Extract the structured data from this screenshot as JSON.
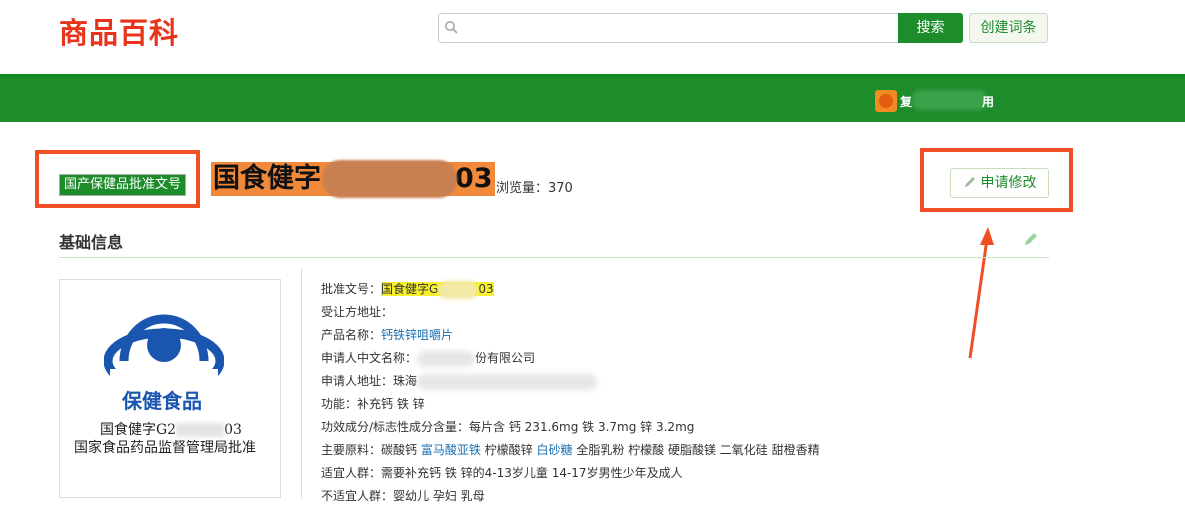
{
  "header": {
    "logo": "商品百科",
    "search_placeholder": "",
    "search_button": "搜索",
    "create_button": "创建词条"
  },
  "user": {
    "name_start": "复",
    "name_end": "用"
  },
  "entry": {
    "type_label": "国产保健品批准文号",
    "title": "国食健字",
    "title_suffix": "03",
    "views_label": "浏览量：",
    "views_value": "370",
    "edit_request_button": "申请修改"
  },
  "section": {
    "title": "基础信息"
  },
  "thumbnail": {
    "logo_text": "保健食品",
    "line2_start": "国食健字G2",
    "line2_end": "03",
    "line3": "国家食品药品监督管理局批准"
  },
  "info": [
    {
      "label": "批准文号：",
      "value": "国食健字G",
      "value_end": "03"
    },
    {
      "label": "受让方地址：",
      "value": ""
    },
    {
      "label": "产品名称：",
      "value": "钙铁锌咀嚼片"
    },
    {
      "label": "申请人中文名称：",
      "value": "份有限公司"
    },
    {
      "label": "申请人地址：",
      "value": "珠海"
    },
    {
      "label": "功能：",
      "value": "补充钙 铁 锌"
    },
    {
      "label": "功效成分/标志性成分含量：",
      "value": "每片含 钙 231.6mg 铁 3.7mg 锌 3.2mg"
    },
    {
      "label": "主要原料：",
      "value_a": "碳酸钙 ",
      "value_b": "富马酸亚铁",
      "value_c": " 柠檬酸锌 ",
      "value_d": "白砂糖",
      "value_e": " 全脂乳粉 柠檬酸 硬脂酸镁 二氧化硅 甜橙香精"
    },
    {
      "label": "适宜人群：",
      "value": "需要补充钙 铁 锌的4-13岁儿童 14-17岁男性少年及成人"
    },
    {
      "label": "不适宜人群：",
      "value": "婴幼儿 孕妇 乳母"
    }
  ],
  "colors": {
    "brand_green": "#1d8c2b",
    "logo_red": "#e8341c",
    "annotation_red": "#f04e23",
    "highlight_yellow": "#f6ef2a",
    "title_highlight": "#f0893a",
    "link_blue": "#1a6fb0"
  }
}
